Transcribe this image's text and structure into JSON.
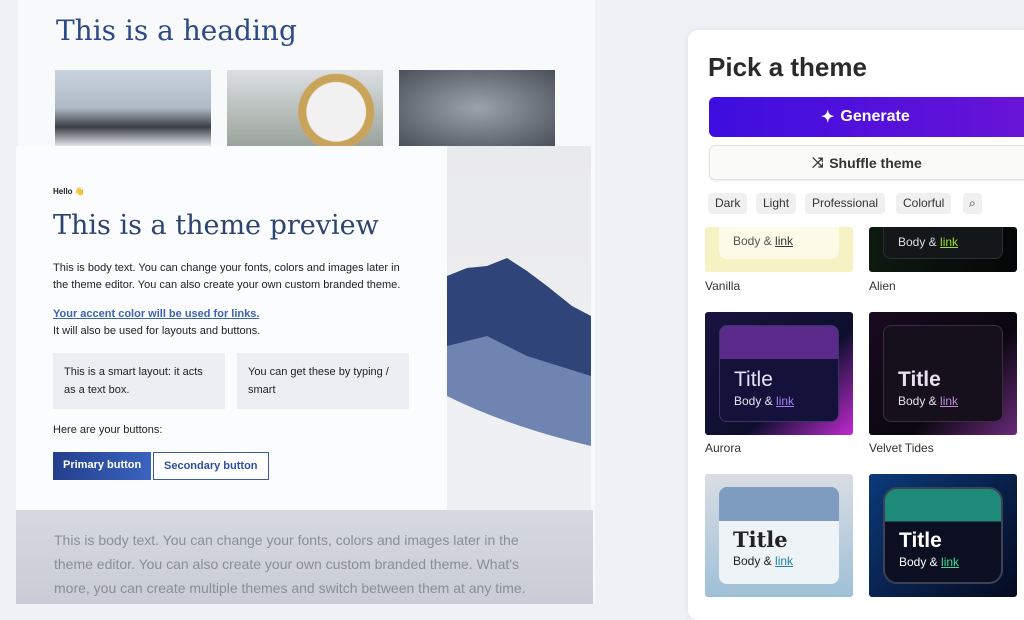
{
  "preview": {
    "heading": "This is a heading",
    "hello": "Hello 👋",
    "title": "This is a theme preview",
    "body": "This is body text. You can change your fonts, colors and images later in the theme editor. You can also create your own custom branded theme.",
    "link": "Your accent color will be used for links.",
    "link_note": "It will also be used for layouts and buttons.",
    "smart_box_1": "This is a smart layout: it acts as a text box.",
    "smart_box_2": "You can get these by typing / smart",
    "buttons_label": "Here are your buttons:",
    "primary_button": "Primary button",
    "secondary_button": "Secondary button",
    "bottom_body": "This is body text. You can change your fonts, colors and images later in the theme editor. You can also create your own custom branded theme. What's more, you can create multiple themes and switch between them at any time.",
    "accent_color": "#2d4fa0"
  },
  "panel": {
    "title": "Pick a theme",
    "generate": "Generate",
    "shuffle": "Shuffle theme",
    "filters": [
      "Dark",
      "Light",
      "Professional",
      "Colorful"
    ],
    "search_icon": "search-icon",
    "themes": [
      {
        "name": "Vanilla",
        "title": "",
        "body": "Body & ",
        "link": "link"
      },
      {
        "name": "Alien",
        "title": "",
        "body": "Body & ",
        "link": "link"
      },
      {
        "name": "Aurora",
        "title": "Title",
        "body": "Body & ",
        "link": "link"
      },
      {
        "name": "Velvet Tides",
        "title": "Title",
        "body": "Body & ",
        "link": "link"
      },
      {
        "name": "",
        "title": "Title",
        "body": "Body & ",
        "link": "link"
      },
      {
        "name": "",
        "title": "Title",
        "body": "Body & ",
        "link": "link"
      }
    ]
  }
}
